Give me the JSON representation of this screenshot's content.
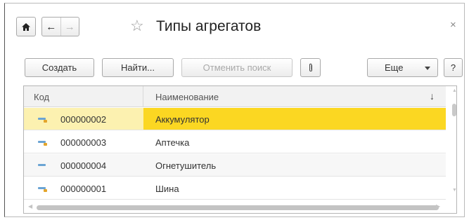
{
  "window": {
    "title": "Типы агрегатов",
    "close_label": "×"
  },
  "nav": {
    "home_icon": "home-icon",
    "back_arrow": "←",
    "forward_arrow": "→",
    "favorite_star": "☆"
  },
  "toolbar": {
    "create_label": "Создать",
    "find_label": "Найти...",
    "cancel_search_label": "Отменить поиск",
    "attach_icon": "paperclip-icon",
    "more_label": "Еще",
    "help_label": "?"
  },
  "table": {
    "headers": {
      "code": "Код",
      "name": "Наименование",
      "sort_indicator": "↓"
    },
    "rows": [
      {
        "code": "000000002",
        "name": "Аккумулятор",
        "selected": true
      },
      {
        "code": "000000003",
        "name": "Аптечка",
        "selected": false
      },
      {
        "code": "000000004",
        "name": "Огнетушитель",
        "selected": false
      },
      {
        "code": "000000001",
        "name": "Шина",
        "selected": false
      }
    ]
  },
  "colors": {
    "selected_name_bg": "#fbd722",
    "selected_code_bg": "#fcf1b0",
    "icon_blue": "#6aa4d4",
    "icon_orange": "#e3a52b"
  }
}
